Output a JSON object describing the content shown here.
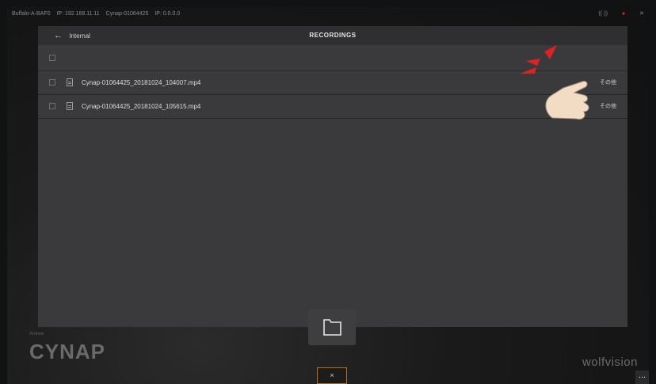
{
  "status_bar": {
    "wifi_label": "Buffalo-A-BAF0",
    "ip_label": "IP: 192.168.11.11",
    "device_label": "Cynap-01064425",
    "lan_ip_label": "IP: 0.0.0.0",
    "right_icons": [
      "broadcast-icon",
      "mic-icon",
      "accessibility-icon"
    ]
  },
  "header": {
    "back_label": "Internal",
    "title": "RECORDINGS"
  },
  "files": [
    {
      "name": "Cynap-01064425_20181024_104007.mp4",
      "action": "その他"
    },
    {
      "name": "Cynap-01064425_20181024_105615.mp4",
      "action": "その他"
    }
  ],
  "branding": {
    "left_logo": "CYNAP",
    "left_small": "Anewe",
    "right_logo": "wolfvision"
  },
  "footer": {
    "close_label": "×",
    "menu_label": "..."
  },
  "colors": {
    "panel": "#3a3a3c",
    "header": "#2f2f31",
    "accent": "#b56b19",
    "alert": "#dd2222",
    "hand": "#f2dcc4"
  }
}
